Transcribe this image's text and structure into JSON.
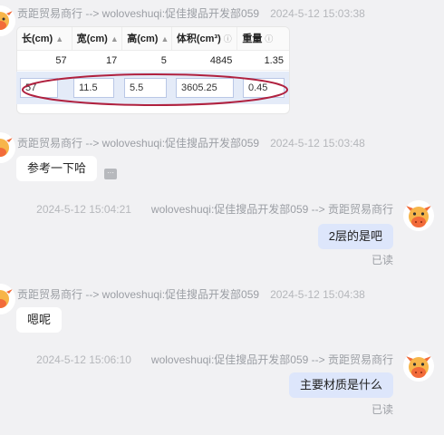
{
  "messages": [
    {
      "sender": "贡距贸易商行 --> woloveshuqi:促佳搜品开发部059",
      "time": "2024-5-12 15:03:38",
      "table": {
        "headers": [
          {
            "label": "长(cm)",
            "icon": "sort-icon"
          },
          {
            "label": "宽(cm)",
            "icon": "sort-icon"
          },
          {
            "label": "高(cm)",
            "icon": "sort-icon"
          },
          {
            "label": "体积(cm³)",
            "icon": "info-icon"
          },
          {
            "label": "重量",
            "icon": "info-icon"
          }
        ],
        "row": [
          "57",
          "17",
          "5",
          "4845",
          "1.35"
        ],
        "edit_row": [
          "57",
          "11.5",
          "5.5",
          "3605.25",
          "0.45"
        ]
      }
    },
    {
      "sender": "贡距贸易商行 --> woloveshuqi:促佳搜品开发部059",
      "time": "2024-5-12 15:03:48",
      "text": "参考一下哈"
    },
    {
      "sender": "woloveshuqi:促佳搜品开发部059 --> 贡距贸易商行",
      "time": "2024-5-12 15:04:21",
      "text": "2层的是吧",
      "status": "已读"
    },
    {
      "sender": "贡距贸易商行 --> woloveshuqi:促佳搜品开发部059",
      "time": "2024-5-12 15:04:38",
      "text": "嗯呢"
    },
    {
      "sender": "woloveshuqi:促佳搜品开发部059 --> 贡距贸易商行",
      "time": "2024-5-12 15:06:10",
      "text": "主要材质是什么",
      "status": "已读"
    }
  ],
  "colors": {
    "background": "#f1f1f3",
    "outgoing_bubble": "#dde6fb",
    "incoming_bubble": "#ffffff",
    "avatar_accent": "#f26b3a",
    "highlight_ellipse": "#b0213f"
  }
}
